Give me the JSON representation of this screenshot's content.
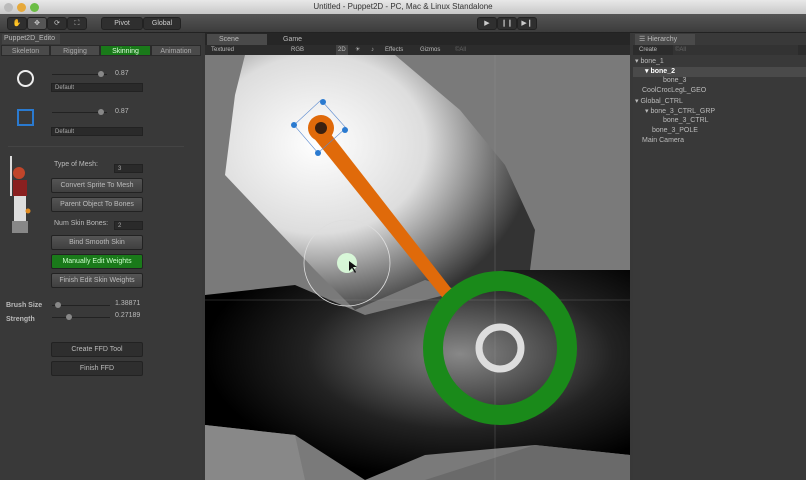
{
  "window": {
    "title": "Untitled - Puppet2D - PC, Mac & Linux Standalone"
  },
  "toolbar": {
    "tools": [
      "hand-icon",
      "move-icon",
      "rotate-icon",
      "scale-icon"
    ],
    "pivot_label": "Pivot",
    "global_label": "Global",
    "play": "▶",
    "pause": "❙❙",
    "step": "▶❙"
  },
  "left_panel": {
    "title": "Puppet2D_Edito",
    "tabs": [
      "Skeleton",
      "Rigging",
      "Skinning",
      "Animation"
    ],
    "active_tab": "Skinning",
    "circle_size": "0.87",
    "circle_dropdown": "Default",
    "square_size": "0.87",
    "square_dropdown": "Default",
    "type_of_mesh_label": "Type of Mesh:",
    "type_of_mesh_value": "3",
    "convert_sprite": "Convert Sprite To Mesh",
    "parent_object": "Parent Object To Bones",
    "num_skin_bones_label": "Num Skin Bones:",
    "num_skin_bones_value": "2",
    "bind_smooth": "Bind Smooth Skin",
    "manually_edit": "Manually Edit Weights",
    "finish_edit": "Finish Edit Skin Weights",
    "brush_size_label": "Brush Size",
    "brush_size_value": "1.38871",
    "brush_size_fraction": 0.05,
    "strength_label": "Strength",
    "strength_value": "0.27189",
    "strength_fraction": 0.27,
    "create_ffd": "Create FFD Tool",
    "finish_ffd": "Finish FFD"
  },
  "scene": {
    "tab_scene": "Scene",
    "tab_game": "Game",
    "shading": "Textured",
    "channel": "RGB",
    "mode_2d": "2D",
    "effects": "Effects",
    "gizmos": "Gizmos",
    "search_placeholder": "©All"
  },
  "hierarchy": {
    "title": "Hierarchy",
    "create": "Create",
    "search_placeholder": "©All",
    "items": [
      "bone_1",
      "bone_2",
      "bone_3",
      "CoolCrocLegL_GEO",
      "Global_CTRL",
      "bone_3_CTRL_GRP",
      "bone_3_CTRL",
      "bone_3_POLE",
      "Main Camera"
    ]
  },
  "colors": {
    "accent_green": "#1a8a1a",
    "bone_orange": "#e06a0a",
    "selection_blue": "#2a7ad0"
  }
}
